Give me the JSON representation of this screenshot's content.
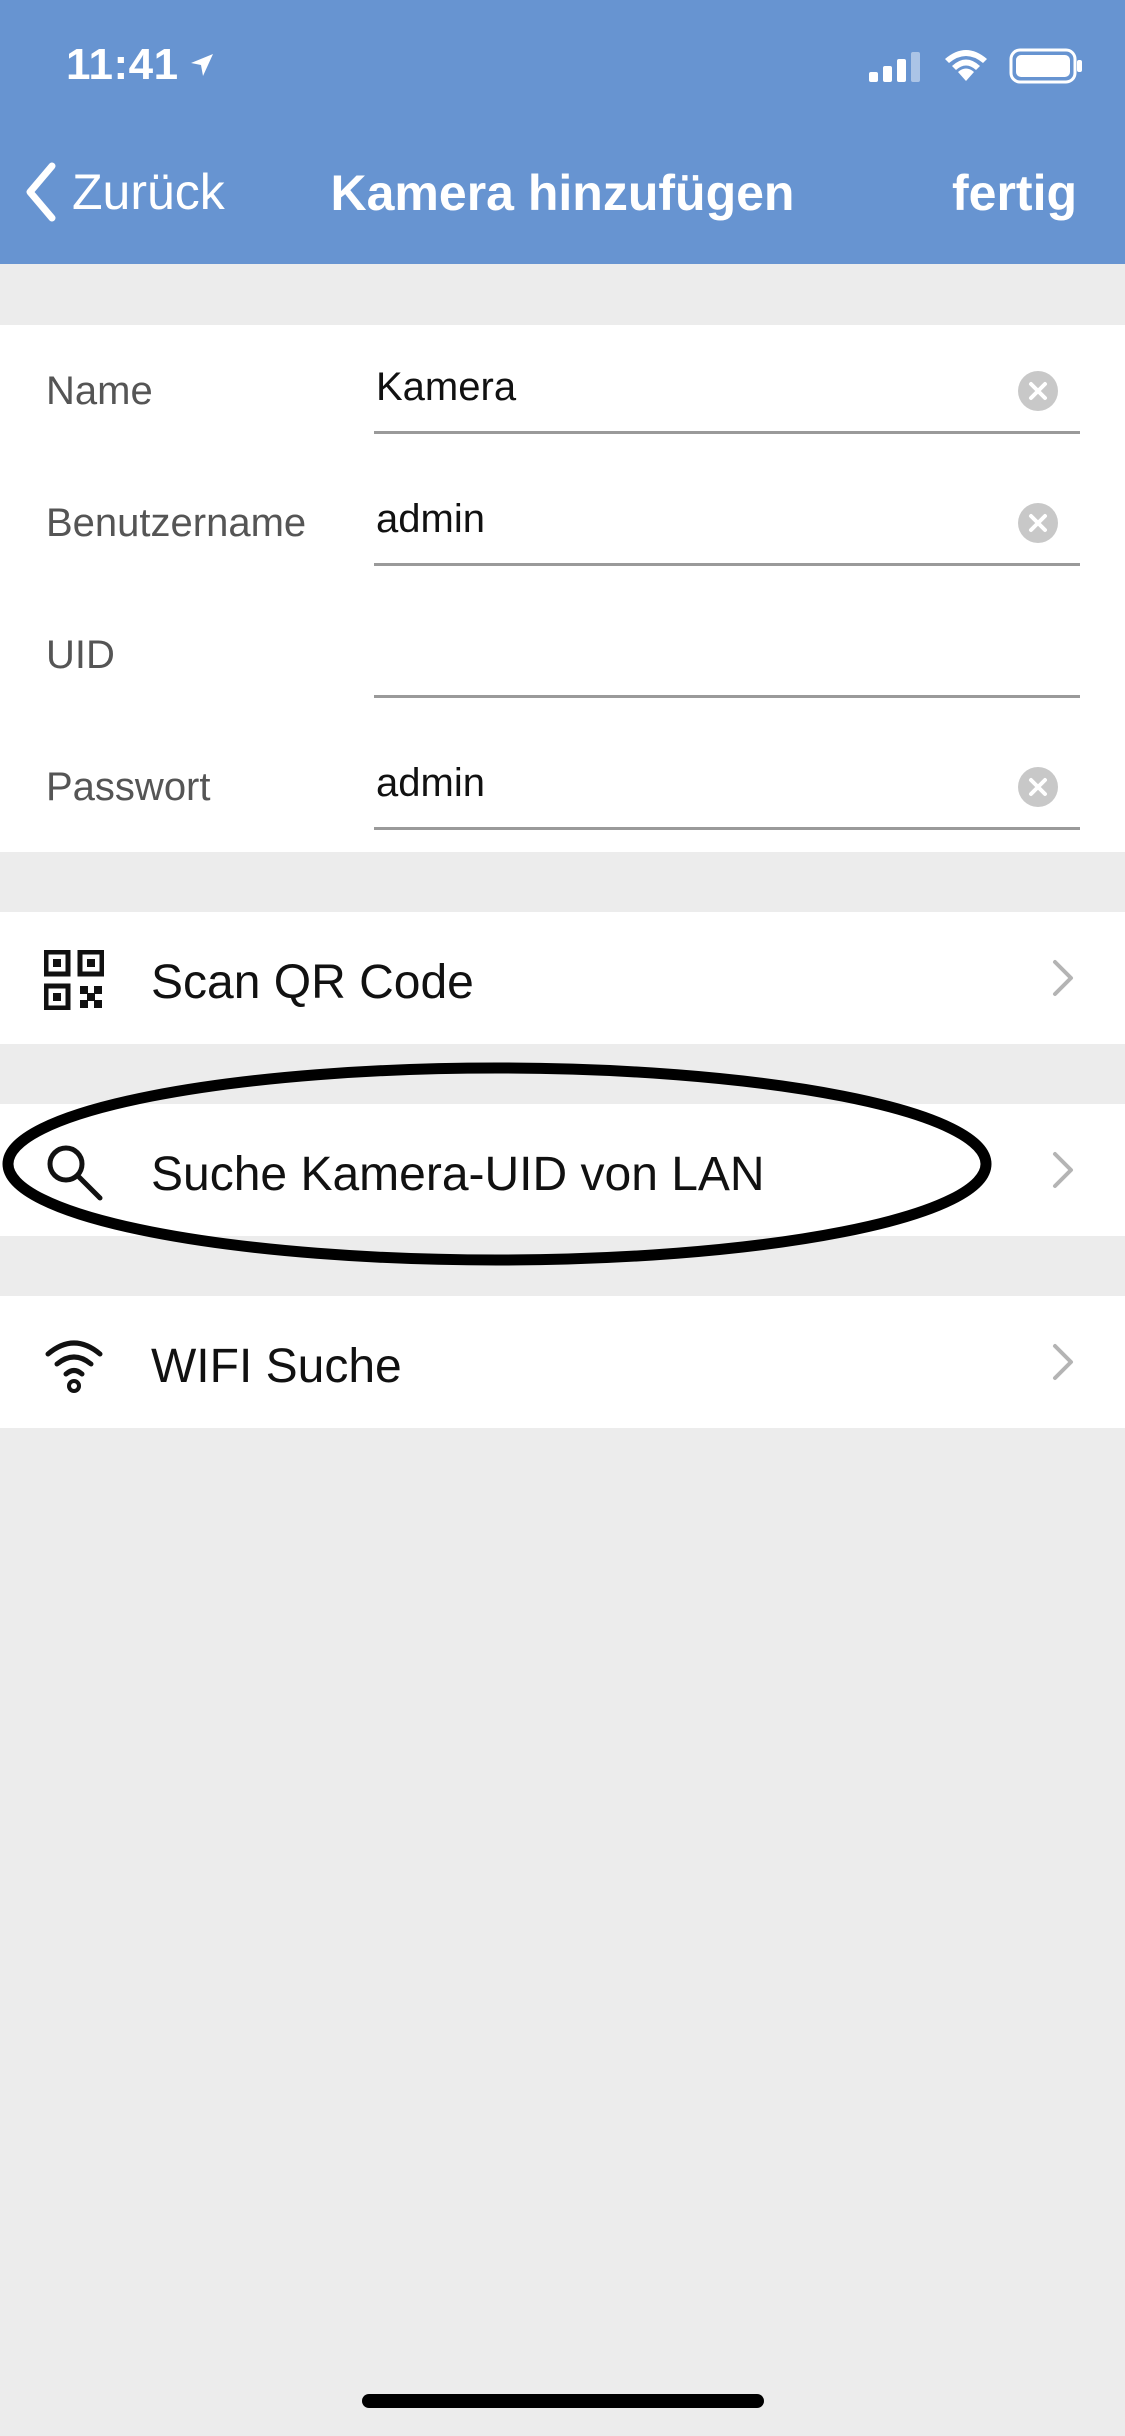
{
  "status_bar": {
    "time": "11:41",
    "location_icon": "location-arrow-icon",
    "signal_icon": "cellular-signal-icon",
    "wifi_icon": "wifi-icon",
    "battery_icon": "battery-icon"
  },
  "nav": {
    "back_label": "Zurück",
    "title": "Kamera hinzufügen",
    "done_label": "fertig",
    "background_color": "#6794d1"
  },
  "form": {
    "fields": [
      {
        "label": "Name",
        "value": "Kamera"
      },
      {
        "label": "Benutzername",
        "value": "admin"
      },
      {
        "label": "UID",
        "value": ""
      },
      {
        "label": "Passwort",
        "value": "admin"
      }
    ]
  },
  "actions": [
    {
      "label": "Scan QR Code",
      "icon": "qr-code-icon"
    },
    {
      "label": "Suche Kamera-UID von LAN",
      "icon": "search-icon",
      "highlighted": true
    },
    {
      "label": "WIFI Suche",
      "icon": "wifi-icon"
    }
  ],
  "colors": {
    "background": "#ececec",
    "annotation_stroke": "#000000"
  }
}
